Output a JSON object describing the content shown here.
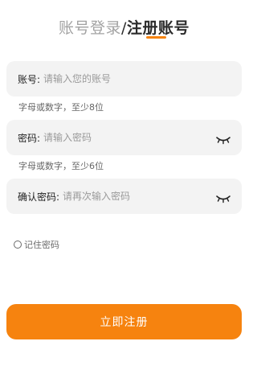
{
  "tabs": {
    "login": "账号登录",
    "separator": "/",
    "register": "注册账号",
    "active": "register"
  },
  "form": {
    "account": {
      "label": "账号:",
      "placeholder": "请输入您的账号",
      "hint": "字母或数字，至少8位"
    },
    "password": {
      "label": "密码:",
      "placeholder": "请输入密码",
      "hint": "字母或数字，至少6位",
      "toggle_icon": "eye-closed-icon"
    },
    "confirm": {
      "label": "确认密码:",
      "placeholder": "请再次输入密码",
      "toggle_icon": "eye-closed-icon"
    },
    "remember_label": "记住密码",
    "remember_checked": false,
    "submit_label": "立即注册"
  },
  "colors": {
    "accent": "#f6830f",
    "field_bg": "#f3f3f3"
  }
}
